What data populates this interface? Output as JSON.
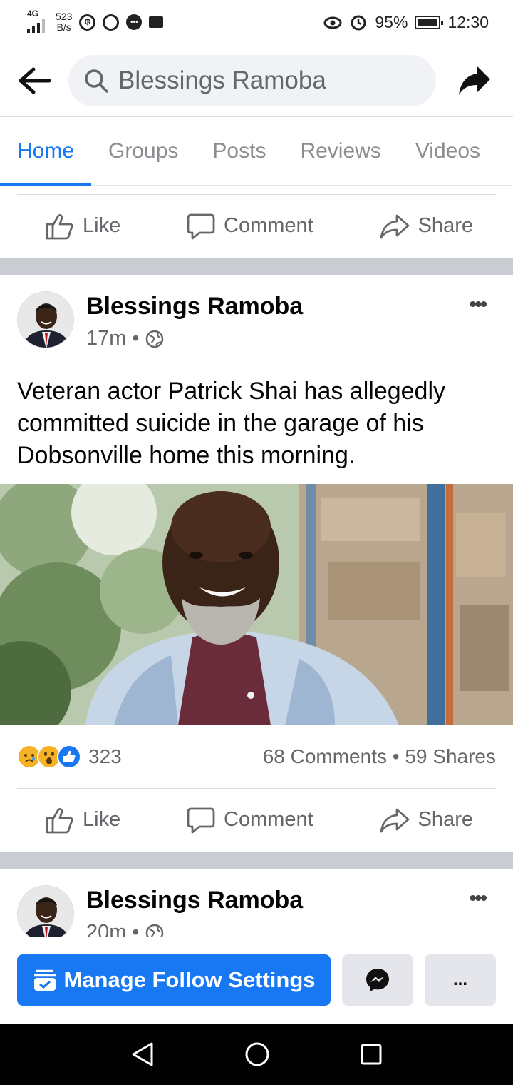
{
  "status_bar": {
    "network": "4G",
    "speed_value": "523",
    "speed_unit": "B/s",
    "battery": "95%",
    "battery_level": 0.95,
    "time": "12:30"
  },
  "header": {
    "search_text": "Blessings Ramoba",
    "icons": {
      "back": "back-arrow-icon",
      "search": "search-icon",
      "share": "share-icon"
    }
  },
  "tabs": [
    {
      "label": "Home",
      "active": true
    },
    {
      "label": "Groups",
      "active": false
    },
    {
      "label": "Posts",
      "active": false
    },
    {
      "label": "Reviews",
      "active": false
    },
    {
      "label": "Videos",
      "active": false
    }
  ],
  "actions": {
    "like": "Like",
    "comment": "Comment",
    "share": "Share"
  },
  "post1": {
    "author": "Blessings Ramoba",
    "time": "17m",
    "separator": "•",
    "text": "Veteran actor Patrick Shai has allegedly committed suicide in the garage of his Dobsonville home this morning.",
    "reaction_count": "323",
    "comments": "68 Comments",
    "shares": "59 Shares",
    "reactions": [
      "sad",
      "wow",
      "like"
    ]
  },
  "post2": {
    "author": "Blessings Ramoba",
    "time": "20m",
    "separator": "•"
  },
  "bottom_bar": {
    "manage_label": "Manage Follow Settings",
    "more_label": "...",
    "accent": "#1877f2"
  }
}
